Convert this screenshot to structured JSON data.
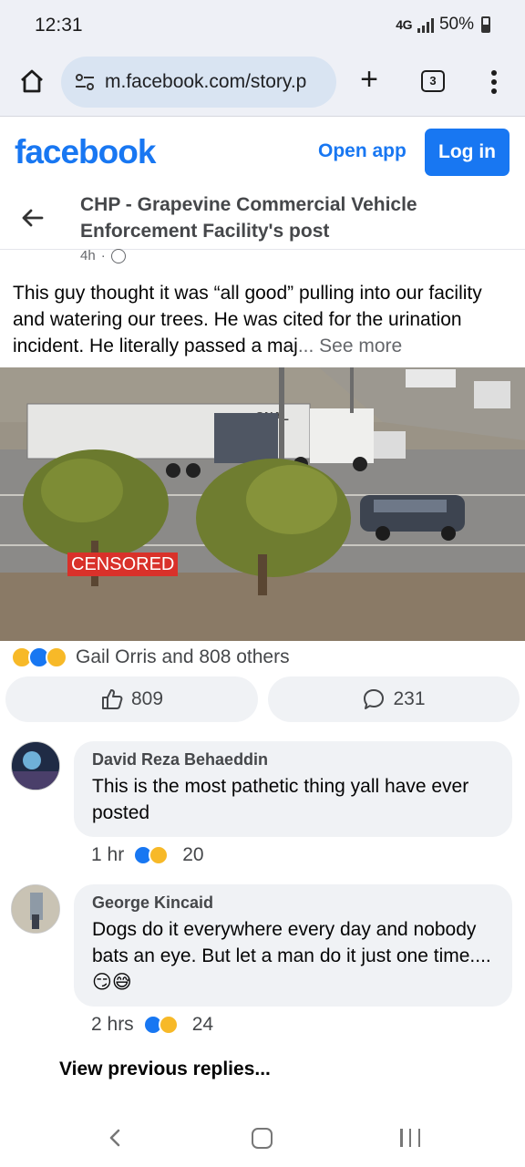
{
  "status_bar": {
    "time": "12:31",
    "network": "4G",
    "battery": "50%"
  },
  "browser": {
    "url": "m.facebook.com/story.p",
    "tab_count": "3"
  },
  "header": {
    "logo": "facebook",
    "open_app_label": "Open app",
    "login_label": "Log in"
  },
  "post": {
    "title": "CHP - Grapevine Commercial Vehicle Enforcement Facility's post",
    "time": "4h",
    "text": "This guy thought it was “all good” pulling into our facility and watering our trees. He was cited for the urination incident. He literally passed a maj",
    "see_more": "... See more",
    "image_overlay_text": "CENSORED",
    "trailer_text": "ONAL",
    "reactions_text": "Gail Orris and 808 others",
    "like_count": "809",
    "comment_count": "231"
  },
  "comments": [
    {
      "author": "David Reza Behaeddin",
      "text": "This is the most pathetic thing yall have ever posted",
      "time": "1 hr",
      "reaction_count": "20"
    },
    {
      "author": "George Kincaid",
      "text": "Dogs do it everywhere every day and nobody bats an eye. But let a man do it just one time....😏😅",
      "time": "2 hrs",
      "reaction_count": "24"
    }
  ],
  "view_previous_label": "View previous replies...",
  "colors": {
    "facebook_blue": "#1877f2",
    "censored_red": "#d9312a"
  }
}
